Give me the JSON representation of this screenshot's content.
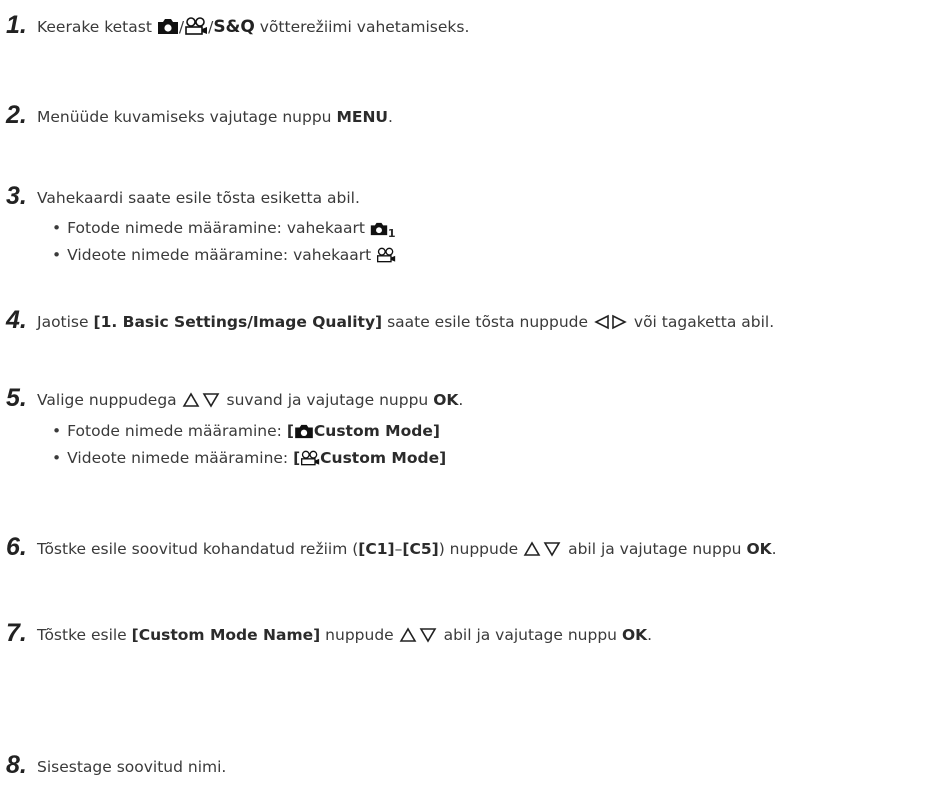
{
  "steps": [
    {
      "num": "1.",
      "parts": [
        "Keerake ketast ",
        "/",
        "/",
        "S&Q",
        " võtterežiimi vahetamiseks."
      ]
    },
    {
      "num": "2.",
      "t1": "Menüüde kuvamiseks vajutage nuppu ",
      "b1": "MENU",
      "t2": "."
    },
    {
      "num": "3.",
      "t1": "Vahekaardi saate esile tõsta esiketta abil.",
      "sub": [
        {
          "text": "Fotode nimede määramine: vahekaart ",
          "subscript": "1"
        },
        {
          "text": "Videote nimede määramine: vahekaart "
        }
      ]
    },
    {
      "num": "4.",
      "t1": "Jaotise ",
      "b1": "[1. Basic Settings/Image Quality]",
      "t2": " saate esile tõsta nuppude ",
      "t3": " või tagaketta abil."
    },
    {
      "num": "5.",
      "t1": "Valige nuppudega ",
      "t2": " suvand ja vajutage nuppu ",
      "b1": "OK",
      "t3": ".",
      "sub": [
        {
          "text": "Fotode nimede määramine: ",
          "b_open": "[",
          "b_close": "Custom Mode]"
        },
        {
          "text": "Videote nimede määramine: ",
          "b_open": "[",
          "b_close": "Custom Mode]"
        }
      ]
    },
    {
      "num": "6.",
      "t1": "Tõstke esile soovitud kohandatud režiim (",
      "b1": "[C1]",
      "t2": "–",
      "b2": "[C5]",
      "t3": ") nuppude ",
      "t4": " abil ja vajutage nuppu ",
      "b3": "OK",
      "t5": "."
    },
    {
      "num": "7.",
      "t1": "Tõstke esile ",
      "b1": "[Custom Mode Name]",
      "t2": " nuppude ",
      "t3": " abil ja vajutage nuppu ",
      "b2": "OK",
      "t4": "."
    },
    {
      "num": "8.",
      "t1": "Sisestage soovitud nimi."
    }
  ],
  "bullet": "•",
  "icons": {
    "camera": "camera-icon",
    "video": "video-camera-icon",
    "left_right": "left-right-arrow-icon",
    "up_down": "up-down-arrow-icon"
  }
}
